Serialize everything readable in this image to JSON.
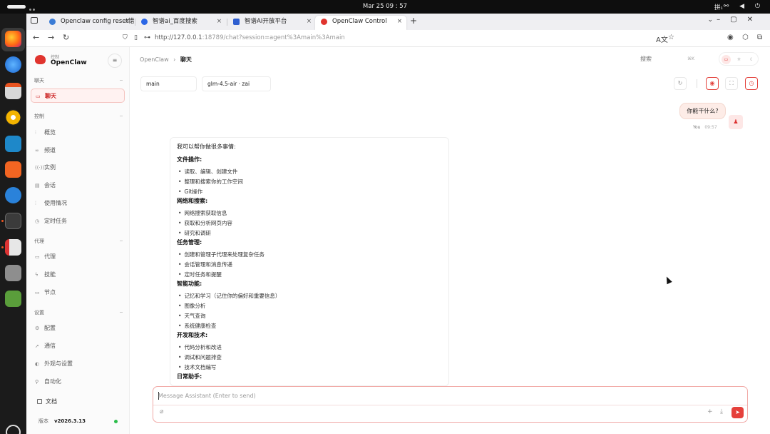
{
  "topbar": {
    "clock": "Mar 25  09 : 57",
    "ime": "拼₁",
    "system_icons": "⚯ ◀ ⏻"
  },
  "browser": {
    "tabs": [
      {
        "title": "Openclaw config reset错",
        "fav": "#3a7bd5"
      },
      {
        "title": "智谱ai_百度搜索",
        "fav": "#2b67e6"
      },
      {
        "title": "智谱AI开放平台",
        "fav": "#2f5fd0"
      },
      {
        "title": "OpenClaw Control",
        "fav": "#e0342e"
      }
    ],
    "close_glyph": "×",
    "new_tab": "+",
    "url_base": "http://127.0.0.1",
    "url_rest": ":18789/chat?session=agent%3Amain%3Amain"
  },
  "sidebar": {
    "brand_sub": "控制",
    "brand_name": "OpenClaw",
    "collapse": "≡",
    "sections": {
      "chat": "聊天",
      "control": "控制",
      "agent": "代理",
      "settings": "设置"
    },
    "items": {
      "chat": "聊天",
      "overview": "概览",
      "channels": "频道",
      "instances": "实例",
      "sessions": "会话",
      "usage": "使用情况",
      "cron": "定时任务",
      "agents": "代理",
      "skills": "技能",
      "nodes": "节点",
      "config": "配置",
      "comms": "通信",
      "appearance": "外观与设置",
      "automation": "自动化"
    },
    "docs": "文档",
    "version_label": "版本",
    "version": "v2026.3.13"
  },
  "header": {
    "crumb_root": "OpenClaw",
    "crumb_sep": "›",
    "crumb_current": "聊天",
    "search": "搜索",
    "search_hint": "⌘K"
  },
  "chat": {
    "agent_select": "main",
    "model_select": "glm-4.5-air · zai",
    "user_message": "你能干什么?",
    "user_label": "You",
    "user_time": "09:57",
    "assistant_intro": "我可以帮你做很多事情:",
    "sections": [
      {
        "title": "文件操作:",
        "items": [
          "读取、编辑、创建文件",
          "整理和搜索你的工作空间",
          "Git操作"
        ]
      },
      {
        "title": "网络和搜索:",
        "items": [
          "网络搜索获取信息",
          "获取和分析网页内容",
          "研究和调研"
        ]
      },
      {
        "title": "任务管理:",
        "items": [
          "创建和管理子代理来处理复杂任务",
          "会话管理和消息传递",
          "定时任务和提醒"
        ]
      },
      {
        "title": "智能功能:",
        "items": [
          "记忆和学习（记住你的偏好和重要信息）",
          "图像分析",
          "天气查询",
          "系统健康检查"
        ]
      },
      {
        "title": "开发和技术:",
        "items": [
          "代码分析和改进",
          "调试和问题排查",
          "技术文档编写"
        ]
      },
      {
        "title": "日常助手:",
        "items": []
      }
    ],
    "composer_placeholder": "Message Assistant (Enter to send)"
  },
  "colors": {
    "accent": "#e5403b",
    "accent_soft": "#fde7e6",
    "online": "#2bbd4a"
  }
}
